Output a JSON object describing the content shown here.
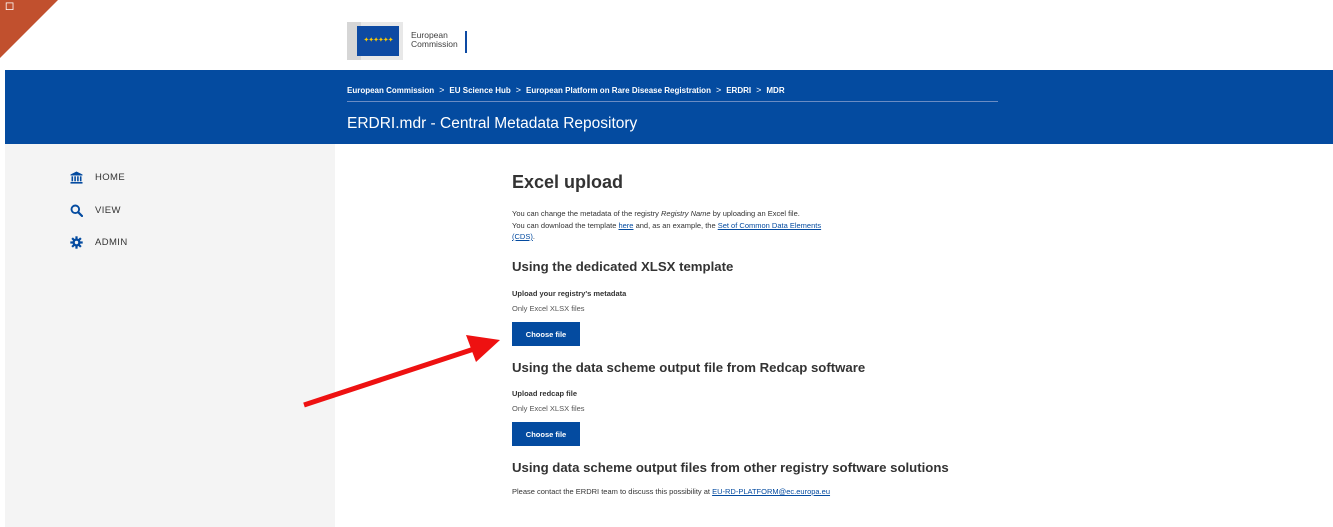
{
  "corner": {
    "glyph": "◇"
  },
  "logo": {
    "line1": "European",
    "line2": "Commission"
  },
  "breadcrumb": [
    "European Commission",
    "EU Science Hub",
    "European Platform on Rare Disease Registration",
    "ERDRI",
    "MDR"
  ],
  "breadcrumb_separator": ">",
  "site_title": "ERDRI.mdr - Central Metadata Repository",
  "sidebar": {
    "items": [
      {
        "label": "HOME",
        "icon": "bank-icon"
      },
      {
        "label": "VIEW",
        "icon": "search-icon"
      },
      {
        "label": "ADMIN",
        "icon": "gear-icon"
      }
    ]
  },
  "main": {
    "title": "Excel upload",
    "intro_line1_a": "You can change the metadata of the registry ",
    "intro_line1_em": "Registry Name",
    "intro_line1_b": " by uploading an Excel file.",
    "intro_line2_a": "You can download the template ",
    "intro_line2_link": "here",
    "intro_line2_b": " and, as an example, the ",
    "intro_line2_link2": "Set of Common Data Elements",
    "intro_line3_link": "(CDS)",
    "intro_line3_b": ".",
    "section1": {
      "heading": "Using the dedicated XLSX template",
      "label": "Upload your registry's metadata",
      "hint": "Only Excel XLSX files",
      "button": "Choose file"
    },
    "section2": {
      "heading": "Using the data scheme output file from Redcap software",
      "label": "Upload redcap file",
      "hint": "Only Excel XLSX files",
      "button": "Choose file"
    },
    "section3": {
      "heading": "Using data scheme output files from other registry software solutions",
      "text": "Please contact the ERDRI team to discuss this possibility at ",
      "email": "EU-RD-PLATFORM@ec.europa.eu"
    }
  },
  "colors": {
    "brand": "#044ba0",
    "corner": "#c1502e",
    "arrow": "#ee1111",
    "sidebar": "#f4f4f4"
  }
}
